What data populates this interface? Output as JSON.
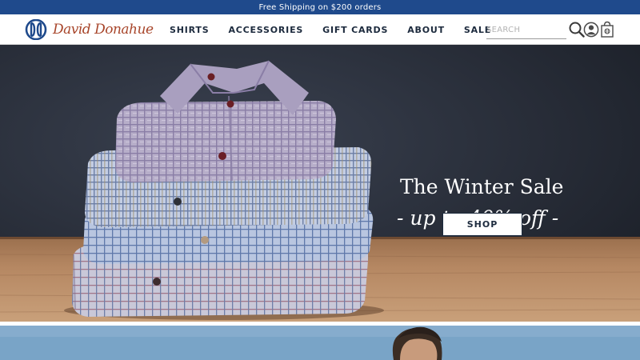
{
  "promo": {
    "text": "Free Shipping on $200 orders"
  },
  "header": {
    "logo_text": "David Donahue",
    "nav": [
      {
        "label": "SHIRTS"
      },
      {
        "label": "ACCESSORIES"
      },
      {
        "label": "GIFT CARDS"
      },
      {
        "label": "ABOUT"
      },
      {
        "label": "SALE"
      }
    ],
    "search": {
      "placeholder": "SEARCH",
      "value": ""
    },
    "icons": [
      "search-icon",
      "account-icon",
      "shopping-bag-icon"
    ]
  },
  "hero": {
    "title": "The Winter Sale",
    "subtitle": "- up to 40% off -",
    "button_label": "SHOP",
    "image": "stack-of-folded-checked-dress-shirts"
  },
  "colors": {
    "promo_bg": "#1f4a8c",
    "logo_mark": "#1f4a8c",
    "logo_text": "#a8462b",
    "nav_text": "#1c2a3d"
  }
}
